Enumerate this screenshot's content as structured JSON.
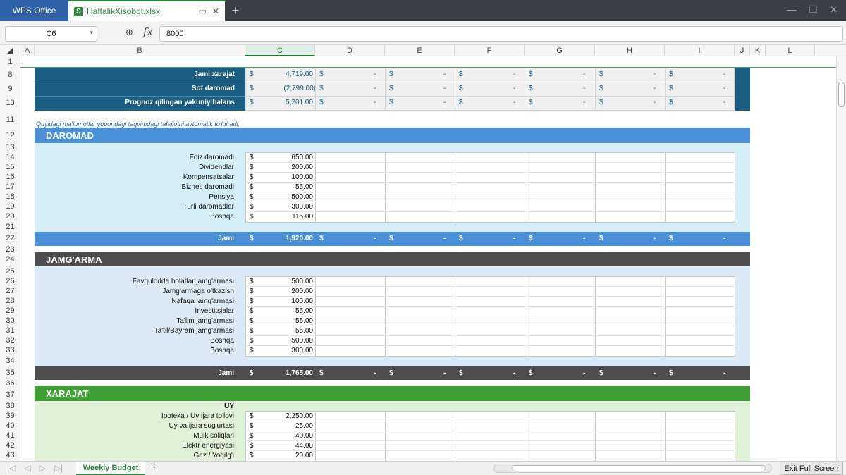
{
  "app": {
    "brand_tab": "WPS Office",
    "file_tab": "HaftalikXisobot.xlsx",
    "file_icon": "S"
  },
  "formula_bar": {
    "cell_ref": "C6",
    "fx": "fx",
    "value": "8000"
  },
  "columns": [
    "A",
    "B",
    "C",
    "D",
    "E",
    "F",
    "G",
    "H",
    "I",
    "J",
    "K",
    "L"
  ],
  "rows": [
    "1",
    "8",
    "9",
    "10",
    "11",
    "12",
    "13",
    "14",
    "15",
    "16",
    "17",
    "18",
    "19",
    "20",
    "21",
    "22",
    "23",
    "24",
    "25",
    "26",
    "27",
    "28",
    "29",
    "30",
    "31",
    "32",
    "33",
    "34",
    "35",
    "36",
    "37",
    "38",
    "39",
    "40",
    "41",
    "42",
    "43"
  ],
  "summary": {
    "rows": [
      {
        "label": "Jami xarajat",
        "value": "4,719.00"
      },
      {
        "label": "Sof daromad",
        "value": "(2,799.00)"
      },
      {
        "label": "Prognoz qilingan yakuniy balans",
        "value": "5,201.00"
      }
    ],
    "dollar": "$",
    "dash": "-"
  },
  "note": "Quyidagi ma'lumotlar yuqoridagi taqvimdagi tafsilotni avtomatik to'ldiradi.",
  "income": {
    "title": "DAROMAD",
    "items": [
      {
        "label": "Foiz daromadi",
        "value": "650.00"
      },
      {
        "label": "Dividendlar",
        "value": "200.00"
      },
      {
        "label": "Kompensatsalar",
        "value": "100.00"
      },
      {
        "label": "Biznes daromadi",
        "value": "55.00"
      },
      {
        "label": "Pensiya",
        "value": "500.00"
      },
      {
        "label": "Turli daromadlar",
        "value": "300.00"
      },
      {
        "label": "Boshqa",
        "value": "115.00"
      }
    ],
    "total_label": "Jami",
    "total_value": "1,920.00"
  },
  "savings": {
    "title": "JAMG'ARMA",
    "items": [
      {
        "label": "Favqulodda holatlar jamg'armasi",
        "value": "500.00"
      },
      {
        "label": "Jamg'armaga o'tkazish",
        "value": "200.00"
      },
      {
        "label": "Nafaqa jamg'armasi",
        "value": "100.00"
      },
      {
        "label": "Investitsialar",
        "value": "55.00"
      },
      {
        "label": "Ta'lim jamg'armasi",
        "value": "55.00"
      },
      {
        "label": "Ta'til/Bayram jamg'armasi",
        "value": "55.00"
      },
      {
        "label": "Boshqa",
        "value": "500.00"
      },
      {
        "label": "Boshqa",
        "value": "300.00"
      }
    ],
    "total_label": "Jami",
    "total_value": "1,765.00"
  },
  "expenses": {
    "title": "XARAJAT",
    "subheader": "UY",
    "items": [
      {
        "label": "Ipoteka / Uy ijara to'lovi",
        "value": "2,250.00"
      },
      {
        "label": "Uy va ijara sug'urtasi",
        "value": "25.00"
      },
      {
        "label": "Mulk soliqlari",
        "value": "40.00"
      },
      {
        "label": "Elektr energiyasi",
        "value": "44.00"
      },
      {
        "label": "Gaz / Yoqilg'i",
        "value": "20.00"
      }
    ]
  },
  "sheet_tabs": {
    "active": "Weekly Budget",
    "add": "+"
  },
  "exit_fullscreen": "Exit Full Screen",
  "colors": {
    "dark_band": "#1b5e84",
    "income_accent": "#4a90d9",
    "savings_accent": "#4d4d4d",
    "expense_accent": "#40a035"
  }
}
